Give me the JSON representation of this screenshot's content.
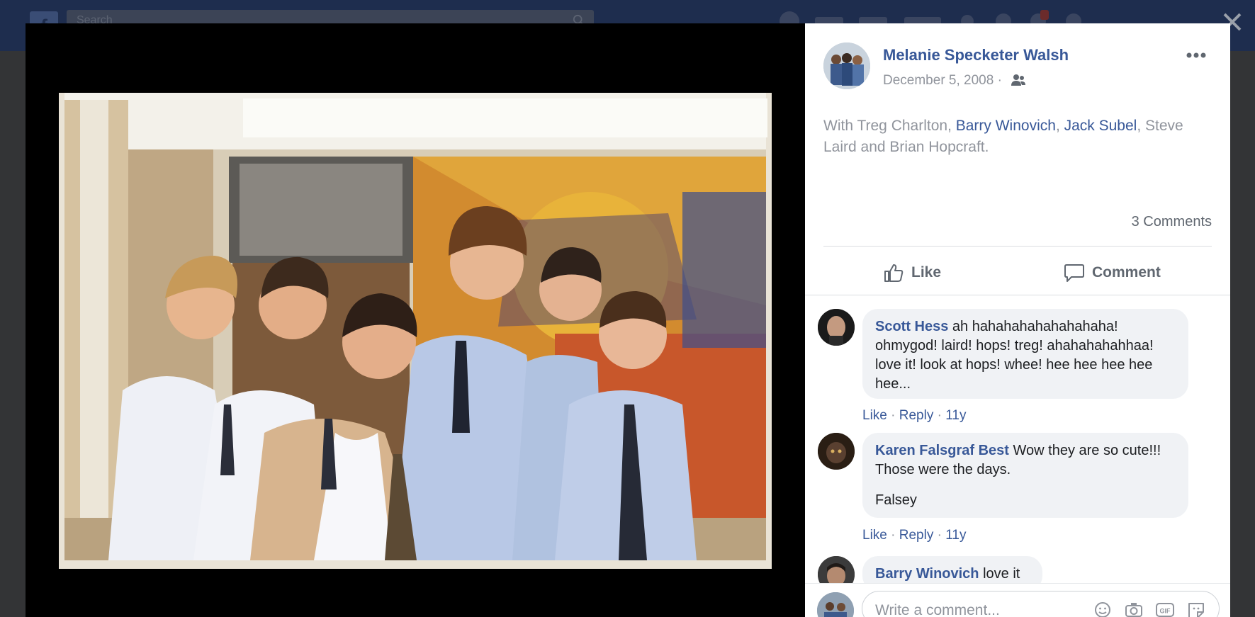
{
  "topbar": {
    "search_placeholder": "Search"
  },
  "post": {
    "author": "Melanie Specketer Walsh",
    "date": "December 5, 2008",
    "date_separator": "·",
    "with_prefix": "With Treg Charlton, ",
    "tag_1": "Barry Winovich",
    "comma_1": ", ",
    "tag_2": "Jack Subel",
    "with_suffix": ", Steve Laird and Brian Hopcraft.",
    "comment_count": "3 Comments",
    "like_label": "Like",
    "comment_label": "Comment"
  },
  "comments": [
    {
      "name": "Scott Hess",
      "text": " ah hahahahahahahahaha! ohmygod! laird! hops! treg! ahahahahahhaa! love it! look at hops! whee! hee hee hee hee hee...",
      "like": "Like",
      "reply": "Reply",
      "age": "11y"
    },
    {
      "name": "Karen Falsgraf Best",
      "text": " Wow they are so cute!!! Those were the days.",
      "extra": "Falsey",
      "like": "Like",
      "reply": "Reply",
      "age": "11y"
    },
    {
      "name": "Barry Winovich",
      "text": " love it"
    }
  ],
  "composer": {
    "placeholder": "Write a comment...",
    "gif_label": "GIF"
  },
  "icons": {
    "close": "close-icon",
    "more": "more-options-icon",
    "audience": "friends-icon",
    "like": "thumbs-up-icon",
    "comment": "speech-bubble-icon",
    "emoji": "emoji-icon",
    "camera": "camera-icon",
    "gif": "gif-icon",
    "sticker": "sticker-icon"
  },
  "colors": {
    "link_blue": "#385898",
    "overlay_black": "#000000",
    "panel_white": "#ffffff",
    "bubble_gray": "#f0f2f5"
  }
}
